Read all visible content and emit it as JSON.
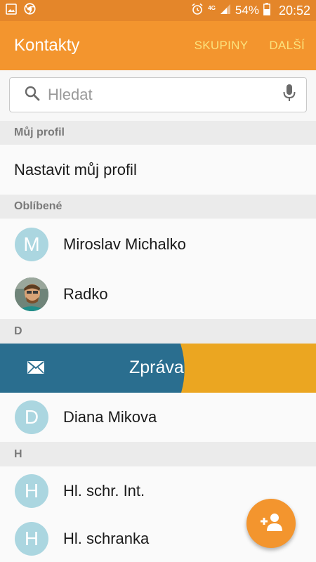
{
  "statusbar": {
    "network": "4G",
    "battery": "54%",
    "time": "20:52"
  },
  "appbar": {
    "title": "Kontakty",
    "actions": [
      "SKUPINY",
      "DALŠÍ"
    ]
  },
  "search": {
    "placeholder": "Hledat"
  },
  "sections": {
    "my_profile": "Můj profil",
    "favorites": "Oblíbené",
    "d": "D",
    "h": "H"
  },
  "profile": {
    "label": "Nastavit můj profil"
  },
  "contacts": [
    {
      "initial": "M",
      "name": "Miroslav Michalko"
    },
    {
      "initial": "",
      "name": "Radko"
    },
    {
      "initial": "D",
      "name": "Diana Mikova"
    },
    {
      "initial": "H",
      "name": "Hl. schr. Int."
    },
    {
      "initial": "H",
      "name": "Hl. schranka"
    }
  ],
  "swipe_action": {
    "label": "Zpráva"
  },
  "colors": {
    "statusbar": "#e4862a",
    "appbar": "#f3952e",
    "action_text": "#fbe27d",
    "avatar": "#abd6e0",
    "swipe_blue": "#2a6e8f",
    "swipe_orange": "#eba621"
  },
  "icons": {
    "search": "search-icon",
    "mic": "mic-icon",
    "message": "envelope-icon",
    "add_contact": "add-contact-icon"
  }
}
